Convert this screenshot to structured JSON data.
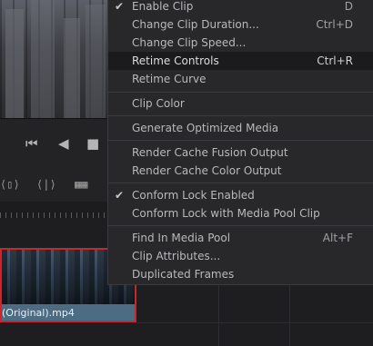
{
  "menu": {
    "items": [
      {
        "label": "Enable Clip",
        "shortcut": "D",
        "checked": true
      },
      {
        "label": "Change Clip Duration...",
        "shortcut": "Ctrl+D"
      },
      {
        "label": "Change Clip Speed...",
        "shortcut": ""
      },
      {
        "label": "Retime Controls",
        "shortcut": "Ctrl+R",
        "highlighted": true
      },
      {
        "label": "Retime Curve",
        "shortcut": ""
      },
      {
        "label": "Clip Color",
        "shortcut": ""
      },
      {
        "label": "Generate Optimized Media",
        "shortcut": ""
      },
      {
        "label": "Render Cache Fusion Output",
        "shortcut": ""
      },
      {
        "label": "Render Cache Color Output",
        "shortcut": ""
      },
      {
        "label": "Conform Lock Enabled",
        "shortcut": "",
        "checked": true
      },
      {
        "label": "Conform Lock with Media Pool Clip",
        "shortcut": ""
      },
      {
        "label": "Find In Media Pool",
        "shortcut": "Alt+F"
      },
      {
        "label": "Clip Attributes...",
        "shortcut": ""
      },
      {
        "label": "Duplicated Frames",
        "shortcut": ""
      }
    ]
  },
  "timeline": {
    "clip_name": "(Original).mp4"
  },
  "colors": {
    "clip_border": "#c9272b",
    "highlight": "#1b1b1d"
  }
}
